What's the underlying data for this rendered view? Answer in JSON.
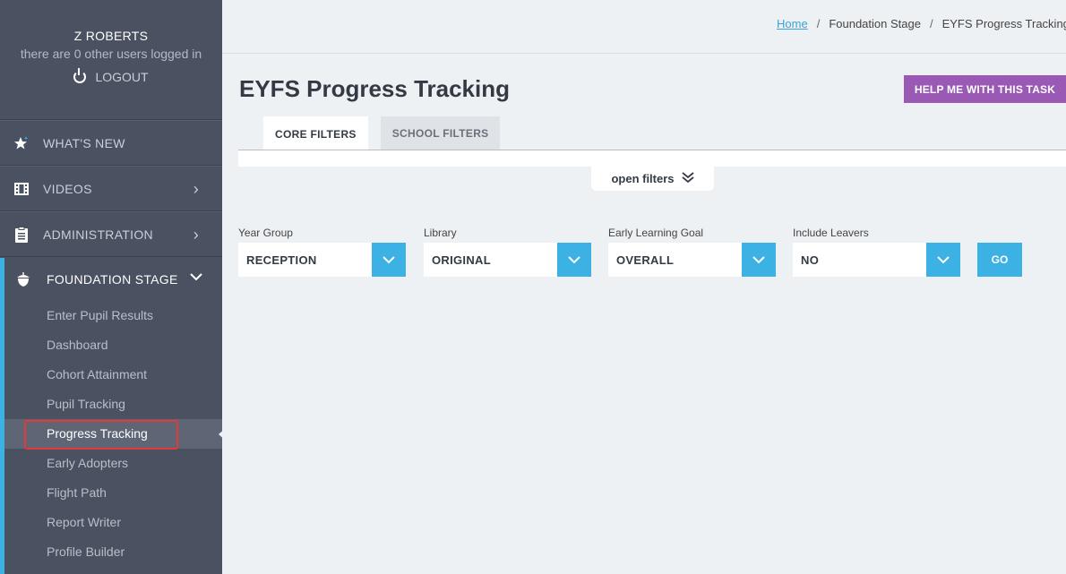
{
  "user": {
    "name": "Z ROBERTS",
    "sub": "there are 0 other users logged in",
    "logout_label": "LOGOUT"
  },
  "nav": [
    {
      "label": "WHAT'S NEW",
      "icon": "star-icon"
    },
    {
      "label": "VIDEOS",
      "icon": "film-icon"
    },
    {
      "label": "ADMINISTRATION",
      "icon": "clipboard-icon"
    }
  ],
  "section": {
    "label": "FOUNDATION STAGE",
    "icon": "acorn-icon",
    "items": [
      "Enter Pupil Results",
      "Dashboard",
      "Cohort Attainment",
      "Pupil Tracking",
      "Progress Tracking",
      "Early Adopters",
      "Flight Path",
      "Report Writer",
      "Profile Builder"
    ],
    "active_index": 4
  },
  "breadcrumb": {
    "home": "Home",
    "level1": "Foundation Stage",
    "current": "EYFS Progress Tracking"
  },
  "page": {
    "title": "EYFS Progress Tracking",
    "help_label": "HELP ME WITH THIS TASK"
  },
  "tabs": {
    "core": "CORE FILTERS",
    "school": "SCHOOL FILTERS"
  },
  "open_filters_label": "open filters",
  "filters": [
    {
      "label": "Year Group",
      "value": "RECEPTION"
    },
    {
      "label": "Library",
      "value": "ORIGINAL"
    },
    {
      "label": "Early Learning Goal",
      "value": "OVERALL"
    },
    {
      "label": "Include Leavers",
      "value": "NO"
    }
  ],
  "go_label": "GO",
  "colors": {
    "accent": "#3bb1e4",
    "help": "#9b59b6",
    "sidebar": "#4a5160"
  }
}
